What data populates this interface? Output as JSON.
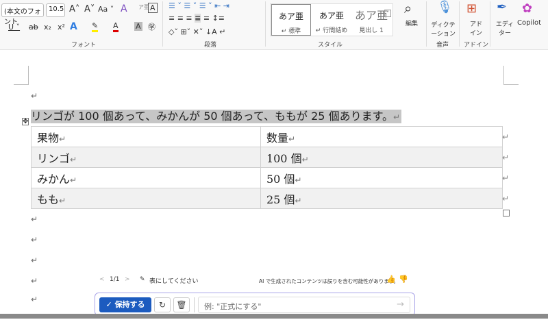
{
  "ribbon": {
    "font": {
      "name": "(本文のフォント",
      "size": "10.5",
      "label": "フォント"
    },
    "paragraph": {
      "label": "段落"
    },
    "styles": {
      "label": "スタイル",
      "items": [
        {
          "preview": "あア亜",
          "name": "↵ 標準"
        },
        {
          "preview": "あア亜",
          "name": "↵ 行間詰め"
        },
        {
          "preview": "あア亜",
          "name": "見出し 1"
        }
      ]
    },
    "edit": {
      "label": "編集"
    },
    "dictate": {
      "label": "ディクテーション",
      "group": "音声"
    },
    "addin": {
      "label": "アドイン",
      "group": "アドイン"
    },
    "editor": {
      "label": "エディター"
    },
    "copilot": {
      "label": "Copilot"
    }
  },
  "document": {
    "sentence": "リンゴが 100 個あって、みかんが 50 個あって、ももが 25 個あります。",
    "pilcrow": "↵",
    "table": {
      "headers": [
        "果物",
        "数量"
      ],
      "rows": [
        [
          "リンゴ",
          "100 個"
        ],
        [
          "みかん",
          "50 個"
        ],
        [
          "もも",
          "25 個"
        ]
      ]
    }
  },
  "copilot_bar": {
    "page": "1/1",
    "prompt": "表にしてください",
    "disclaimer": "AI で生成されたコンテンツは誤りを含む可能性があります。",
    "keep_label": "保持する",
    "input_placeholder": "例: \"正式にする\""
  }
}
